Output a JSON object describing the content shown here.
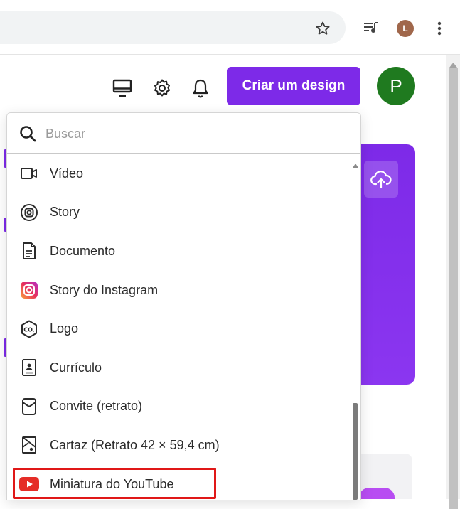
{
  "browser": {
    "profile_initial": "L"
  },
  "header": {
    "create_button_label": "Criar um design",
    "user_initial": "P"
  },
  "dropdown": {
    "search_placeholder": "Buscar",
    "items": [
      {
        "label": "Vídeo",
        "icon": "video-icon"
      },
      {
        "label": "Story",
        "icon": "story-icon"
      },
      {
        "label": "Documento",
        "icon": "document-icon"
      },
      {
        "label": "Story do Instagram",
        "icon": "instagram-icon"
      },
      {
        "label": "Logo",
        "icon": "logo-icon"
      },
      {
        "label": "Currículo",
        "icon": "resume-icon"
      },
      {
        "label": "Convite (retrato)",
        "icon": "invitation-icon"
      },
      {
        "label": "Cartaz (Retrato 42 × 59,4 cm)",
        "icon": "poster-icon"
      },
      {
        "label": "Miniatura do YouTube",
        "icon": "youtube-icon",
        "highlighted": true
      }
    ]
  },
  "colors": {
    "brand_purple": "#7d2ae8",
    "avatar_green": "#1f7a1f",
    "highlight_red": "#e01818",
    "youtube_red": "#e52d27"
  }
}
